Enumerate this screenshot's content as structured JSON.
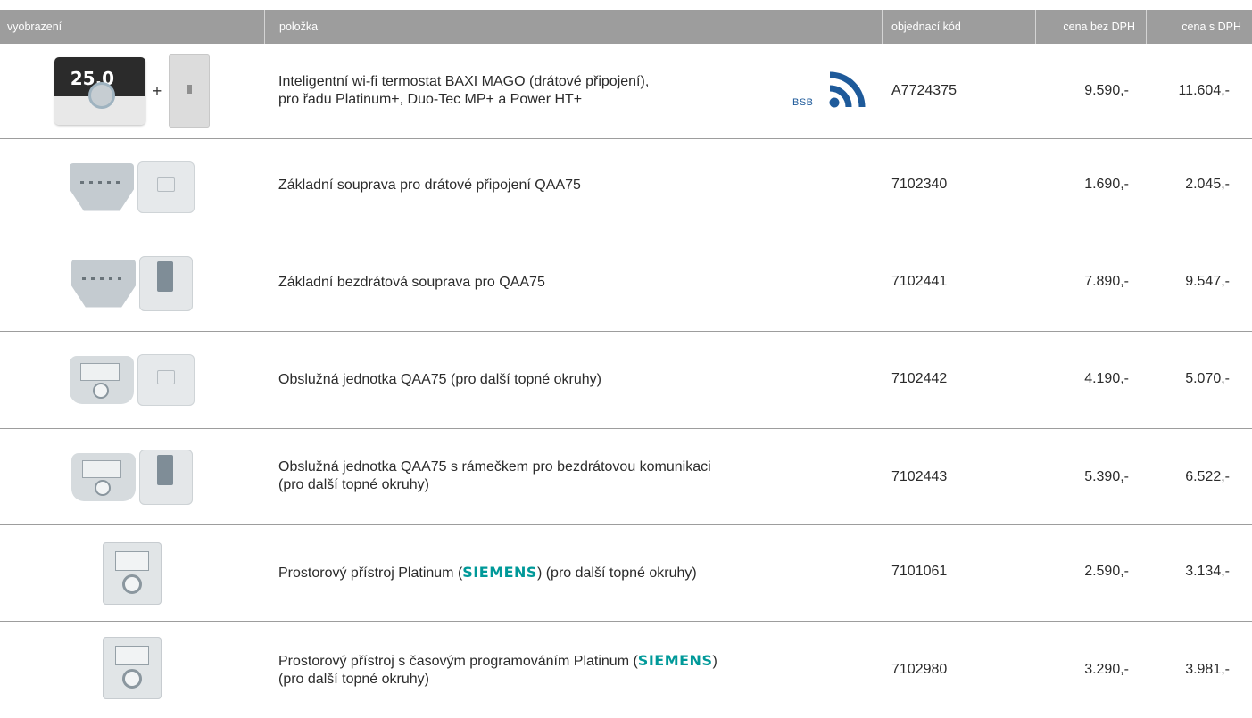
{
  "columns": {
    "image": "vyobrazení",
    "item": "položka",
    "code": "objednací kód",
    "price_net": "cena bez DPH",
    "price_gross": "cena s DPH"
  },
  "plus_sign": "+",
  "thermostat_display": "25.0",
  "bsb_label": "BSB",
  "siemens_brand": "SIEMENS",
  "colors": {
    "header_bg": "#9d9d9d",
    "siemens": "#009999",
    "wifi": "#1e5a9a"
  },
  "rows": [
    {
      "line1": "Inteligentní wi-fi termostat BAXI MAGO (drátové připojení),",
      "line2": "pro řadu Platinum+, Duo-Tec MP+ a Power HT+",
      "code": "A7724375",
      "price_net": "9.590,-",
      "price_gross": "11.604,-",
      "icons": [
        "bsb-label",
        "wifi-icon"
      ]
    },
    {
      "line1": "Základní souprava pro drátové připojení QAA75",
      "code": "7102340",
      "price_net": "1.690,-",
      "price_gross": "2.045,-"
    },
    {
      "line1": "Základní bezdrátová souprava pro QAA75",
      "code": "7102441",
      "price_net": "7.890,-",
      "price_gross": "9.547,-"
    },
    {
      "line1": "Obslužná jednotka QAA75 (pro další topné okruhy)",
      "code": "7102442",
      "price_net": "4.190,-",
      "price_gross": "5.070,-"
    },
    {
      "line1": "Obslužná jednotka QAA75 s rámečkem pro bezdrátovou komunikaci",
      "line2": "(pro další topné okruhy)",
      "code": "7102443",
      "price_net": "5.390,-",
      "price_gross": "6.522,-"
    },
    {
      "line1_pre": "Prostorový přístroj Platinum (",
      "line1_post": ") (pro další topné okruhy)",
      "code": "7101061",
      "price_net": "2.590,-",
      "price_gross": "3.134,-"
    },
    {
      "line1_pre": "Prostorový přístroj s časovým programováním Platinum (",
      "line1_post": ")",
      "line2": "(pro další topné okruhy)",
      "code": "7102980",
      "price_net": "3.290,-",
      "price_gross": "3.981,-"
    }
  ]
}
